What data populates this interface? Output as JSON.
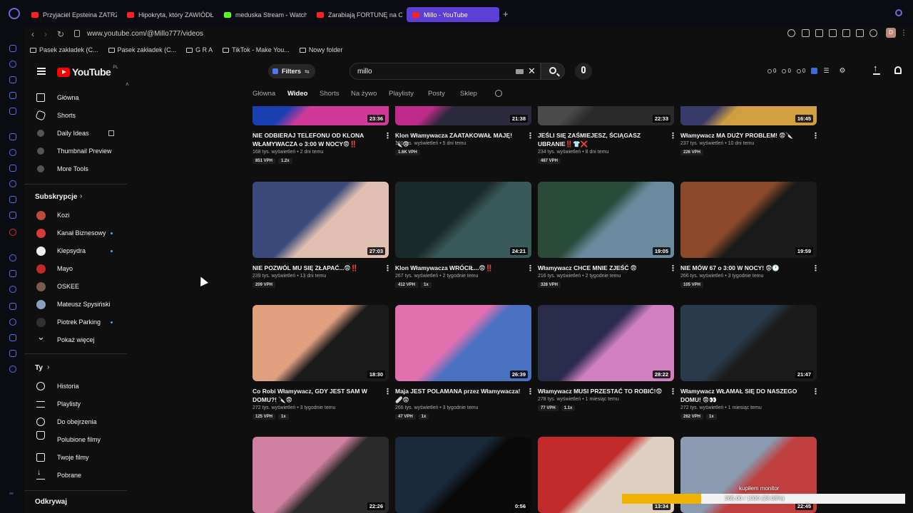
{
  "browser": {
    "tabs": [
      {
        "label": "Przyjaciel Epsteina ZATRZ",
        "active": false,
        "icon": "youtube-icon"
      },
      {
        "label": "Hipokryta, który ZAWIÓDŁ",
        "active": false,
        "icon": "youtube-icon"
      },
      {
        "label": "meduska Stream - Watch",
        "active": false,
        "icon": "kick-icon"
      },
      {
        "label": "Zarabiają FORTUNĘ na OC",
        "active": false,
        "icon": "youtube-icon"
      },
      {
        "label": "Millo - YouTube",
        "active": true,
        "icon": "youtube-icon"
      }
    ],
    "new_tab": "+",
    "url": "www.youtube.com/@Millo777/videos",
    "profile_initial": "D",
    "bookmarks": [
      {
        "label": "Pasek zakładek (C..."
      },
      {
        "label": "Pasek zakładek (C..."
      },
      {
        "label": "G R A"
      },
      {
        "label": "TikTok - Make You..."
      },
      {
        "label": "Nowy folder"
      }
    ]
  },
  "masthead": {
    "logo_text": "YouTube",
    "region": "PL",
    "filters_label": "Filters",
    "search_value": "millo",
    "stats": [
      "0",
      "0",
      "0"
    ]
  },
  "sidebar": {
    "main": [
      {
        "label": "Główna",
        "icon": "home-icon"
      },
      {
        "label": "Shorts",
        "icon": "shorts-icon"
      },
      {
        "label": "Daily Ideas",
        "icon": "ext-dot-icon"
      },
      {
        "label": "Thumbnail Preview",
        "icon": "ext-dot-icon"
      },
      {
        "label": "More Tools",
        "icon": "ext-dot-icon"
      }
    ],
    "subs_title": "Subskrypcje",
    "subscriptions": [
      {
        "label": "Kozi",
        "color": "#c04a3a",
        "new": false
      },
      {
        "label": "Kanał Biznesowy",
        "color": "#d83a3a",
        "new": true
      },
      {
        "label": "Klepsydra",
        "color": "#eeeeee",
        "new": true
      },
      {
        "label": "Mayo",
        "color": "#c22a2a",
        "new": false
      },
      {
        "label": "OSKEE",
        "color": "#7a5a4a",
        "new": false
      },
      {
        "label": "Mateusz Spysiński",
        "color": "#8aa0c0",
        "new": false
      },
      {
        "label": "Piotrek Parking",
        "color": "#303030",
        "new": true
      },
      {
        "label": "Pokaż więcej",
        "color": "",
        "new": false
      }
    ],
    "you_title": "Ty",
    "you": [
      {
        "label": "Historia",
        "icon": "history-icon"
      },
      {
        "label": "Playlisty",
        "icon": "playlist-icon"
      },
      {
        "label": "Do obejrzenia",
        "icon": "clock-icon"
      },
      {
        "label": "Polubione filmy",
        "icon": "like-icon"
      },
      {
        "label": "Twoje filmy",
        "icon": "video-icon"
      },
      {
        "label": "Pobrane",
        "icon": "download-icon"
      }
    ],
    "explore_title": "Odkrywaj"
  },
  "channel_tabs": [
    {
      "label": "Główna",
      "active": false
    },
    {
      "label": "Wideo",
      "active": true
    },
    {
      "label": "Shorts",
      "active": false
    },
    {
      "label": "Na żywo",
      "active": false
    },
    {
      "label": "Playlisty",
      "active": false
    },
    {
      "label": "Posty",
      "active": false
    },
    {
      "label": "Sklep",
      "active": false
    }
  ],
  "videos": [
    {
      "title": "NIE ODBIERAJ TELEFONU OD KLONA WŁAMYWACZA o 3:00 W NOCY😨‼️",
      "duration": "23:36",
      "meta": "168 tys. wyświetleń • 2 dni temu",
      "badges": [
        "851 VPH",
        "1.2x"
      ],
      "colors": [
        "#1a3fb0",
        "#d23a9a"
      ]
    },
    {
      "title": "Klon Włamywacza ZAATAKOWAŁ MAJĘ! 🔪😨",
      "duration": "21:38",
      "meta": "191 tys. wyświetleń • 5 dni temu",
      "badges": [
        "1.6K VPH"
      ],
      "colors": [
        "#c02a8a",
        "#2a2a3a"
      ]
    },
    {
      "title": "JEŚLI SIĘ ZAŚMIEJESZ, ŚCIĄGASZ UBRANIE‼️👕❌",
      "duration": "22:33",
      "meta": "234 tys. wyświetleń • 8 dni temu",
      "badges": [
        "487 VPH"
      ],
      "colors": [
        "#4a4a4a",
        "#2a2a2a"
      ]
    },
    {
      "title": "Włamywacz MA DUŻY PROBLEM! 😨🔪",
      "duration": "16:45",
      "meta": "237 tys. wyświetleń • 10 dni temu",
      "badges": [
        "226 VPH"
      ],
      "colors": [
        "#3a3a6a",
        "#d0a040"
      ]
    },
    {
      "title": "NIE POZWÓL MU SIĘ ZŁAPAĆ...😨‼️",
      "duration": "27:03",
      "meta": "239 tys. wyświetleń • 13 dni temu",
      "badges": [
        "209 VPH"
      ],
      "colors": [
        "#3a4a7a",
        "#e0c0b0"
      ]
    },
    {
      "title": "Klon Włamywacza WRÓCIŁ...😨‼️",
      "duration": "24:21",
      "meta": "267 tys. wyświetleń • 2 tygodnie temu",
      "badges": [
        "412 VPH",
        "1x"
      ],
      "colors": [
        "#1a2a2a",
        "#3a5a5a"
      ]
    },
    {
      "title": "Włamywacz CHCE MNIE ZJEŚĆ 😨",
      "duration": "19:05",
      "meta": "216 tys. wyświetleń • 2 tygodnie temu",
      "badges": [
        "328 VPH"
      ],
      "colors": [
        "#2a4a3a",
        "#6a8aa0"
      ]
    },
    {
      "title": "NIE MÓW 67 o 3:00 W NOCY! 😨🕐",
      "duration": "19:59",
      "meta": "266 tys. wyświetleń • 3 tygodnie temu",
      "badges": [
        "105 VPH"
      ],
      "colors": [
        "#8a4a2a",
        "#1a1a1a"
      ]
    },
    {
      "title": "Co Robi Włamywacz, GDY JEST SAM W DOMU?! 🔪😨",
      "duration": "18:30",
      "meta": "272 tys. wyświetleń • 3 tygodnie temu",
      "badges": [
        "125 VPH",
        "1x"
      ],
      "colors": [
        "#e0a080",
        "#1a1a1a"
      ]
    },
    {
      "title": "Maja JEST POLAMANA przez Włamywacza! 🩹😨",
      "duration": "26:39",
      "meta": "266 tys. wyświetleń • 3 tygodnie temu",
      "badges": [
        "47 VPH",
        "1x"
      ],
      "colors": [
        "#e070b0",
        "#4a70c0"
      ]
    },
    {
      "title": "Włamywacz MUSI PRZESTAĆ TO ROBIĆ!😨",
      "duration": "28:22",
      "meta": "278 tys. wyświetleń • 1 miesiąc temu",
      "badges": [
        "77 VPH",
        "1.1x"
      ],
      "colors": [
        "#2a2a4a",
        "#d080c0"
      ]
    },
    {
      "title": "Włamywacz WŁAMAŁ SIĘ DO NASZEGO DOMU! 😨👀",
      "duration": "21:47",
      "meta": "272 tys. wyświetleń • 1 miesiąc temu",
      "badges": [
        "262 VPH",
        "1x"
      ],
      "colors": [
        "#2a3a4a",
        "#1a1a1a"
      ]
    },
    {
      "title": "",
      "duration": "22:26",
      "meta": "",
      "badges": [],
      "colors": [
        "#d080a0",
        "#2a2a2a"
      ]
    },
    {
      "title": "",
      "duration": "0:56",
      "meta": "",
      "badges": [],
      "colors": [
        "#1a2a3a",
        "#0a0a0a"
      ]
    },
    {
      "title": "",
      "duration": "13:34",
      "meta": "",
      "badges": [],
      "colors": [
        "#c02a2a",
        "#e0d0c0"
      ]
    },
    {
      "title": "",
      "duration": "22:45",
      "meta": "",
      "badges": [],
      "colors": [
        "#8a9ab0",
        "#c04040"
      ]
    }
  ],
  "overlay": {
    "caption": "kupiłem monitor",
    "progress_text": "365.00 / 1300 (28.08%)",
    "progress_fraction": 0.2808,
    "fill_color": "#f0b400"
  }
}
